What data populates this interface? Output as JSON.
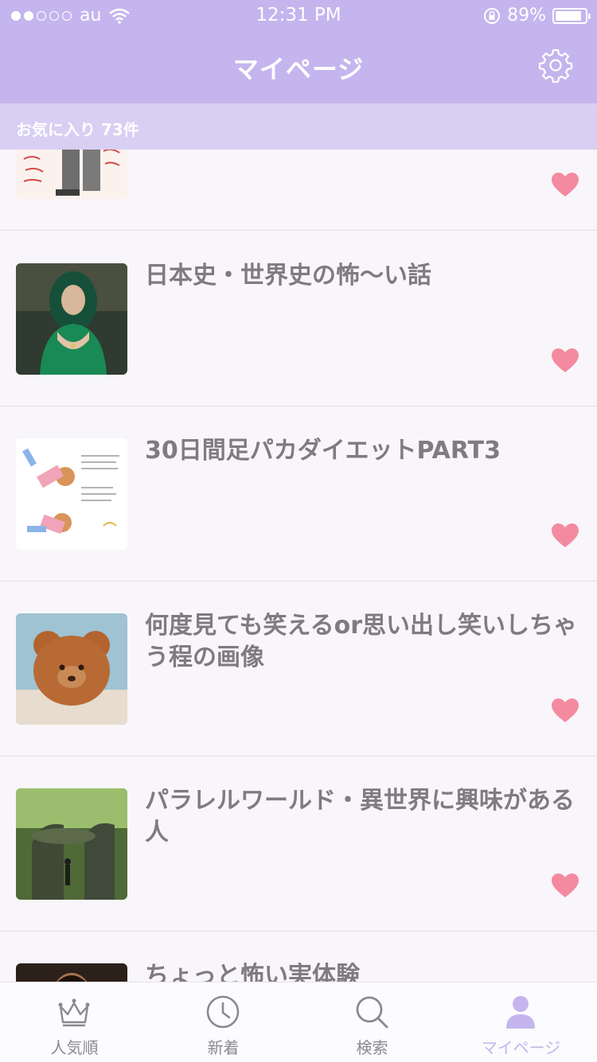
{
  "status": {
    "carrier": "au",
    "time": "12:31 PM",
    "battery": "89%",
    "battery_level": 0.89
  },
  "nav": {
    "title": "マイページ",
    "settings_icon": "gear-icon"
  },
  "favorites": {
    "count_label": "お気に入り 73件"
  },
  "items": [
    {
      "title": ""
    },
    {
      "title": "日本史・世界史の怖〜い話"
    },
    {
      "title": "30日間足パカダイエットPART3"
    },
    {
      "title": "何度見ても笑えるor思い出し笑いしちゃう程の画像"
    },
    {
      "title": "パラレルワールド・異世界に興味がある人"
    },
    {
      "title": "ちょっと怖い実体験"
    }
  ],
  "tabs": [
    {
      "label": "人気順",
      "icon": "crown-icon"
    },
    {
      "label": "新着",
      "icon": "clock-icon"
    },
    {
      "label": "検索",
      "icon": "search-icon"
    },
    {
      "label": "マイページ",
      "icon": "person-icon",
      "active": true
    }
  ],
  "colors": {
    "accent": "#c4b5ee",
    "heart": "#f48aa0",
    "text": "#7f7b7f"
  }
}
